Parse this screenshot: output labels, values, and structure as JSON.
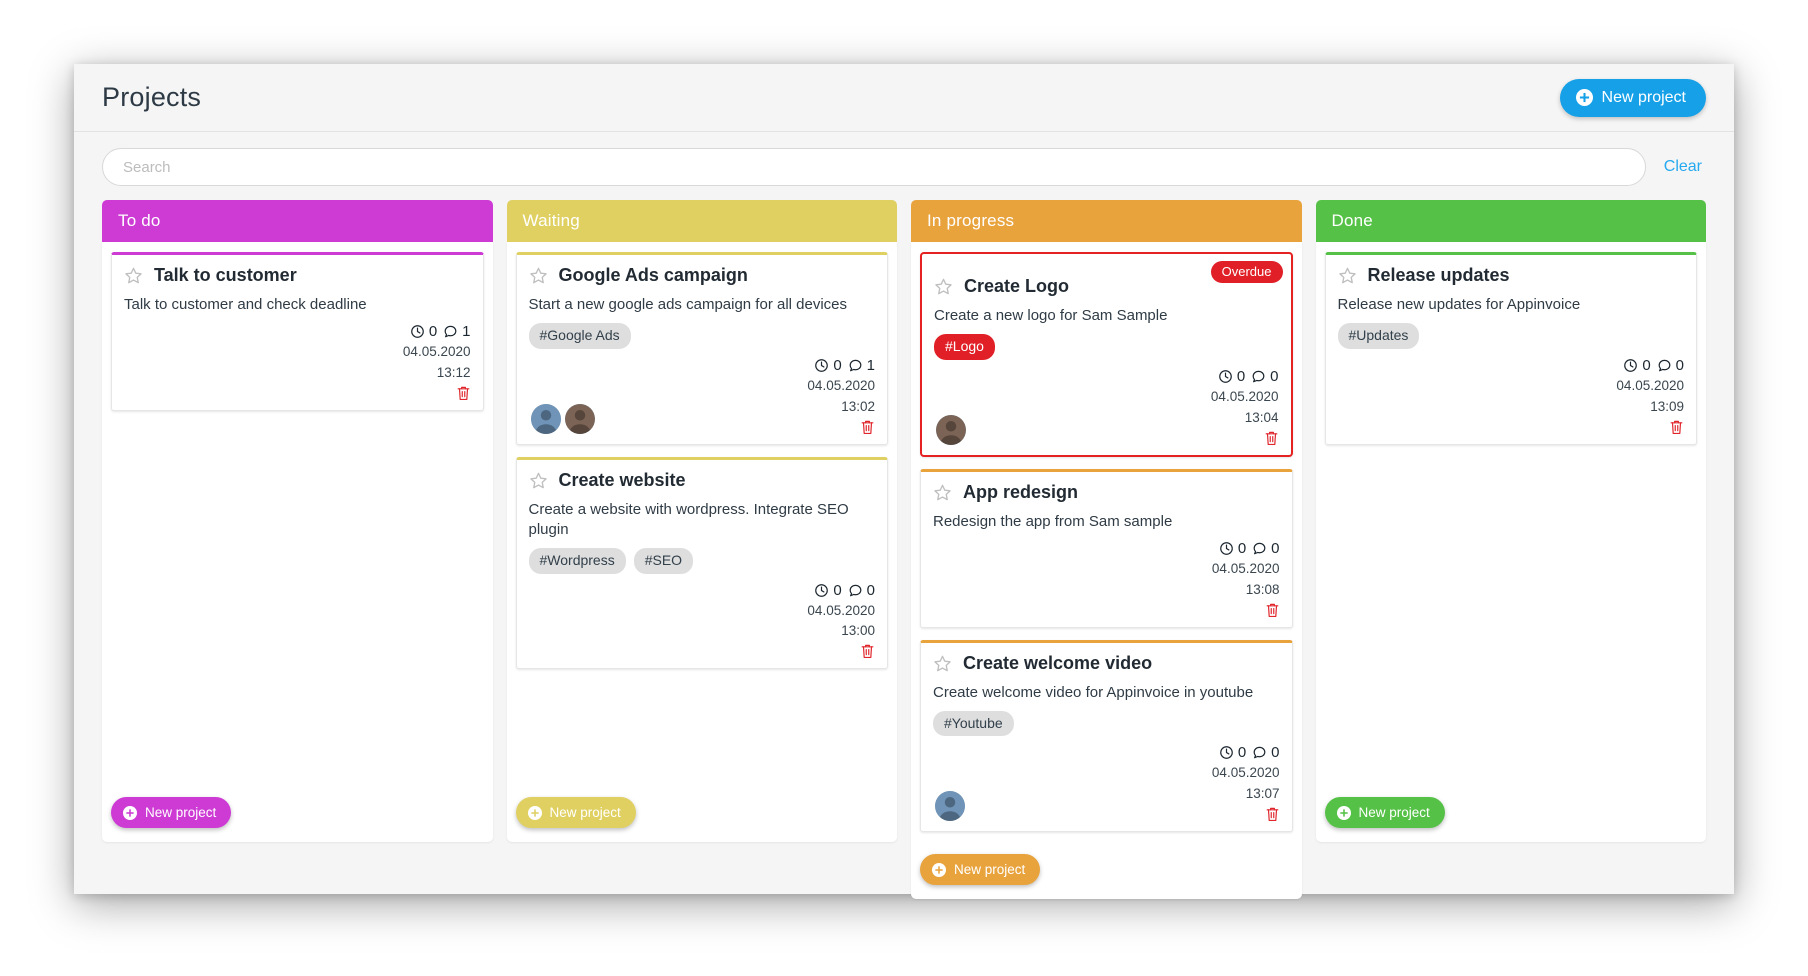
{
  "header": {
    "title": "Projects",
    "new_project_label": "New project",
    "new_project_icon": "plus-circle-icon",
    "accent": "#15a0e8"
  },
  "search": {
    "placeholder": "Search",
    "value": "",
    "clear_label": "Clear"
  },
  "columns": [
    {
      "id": "todo",
      "title": "To do",
      "color": "#cd3ad4",
      "add_label": "New project",
      "cards": [
        {
          "title": "Talk to customer",
          "description": "Talk to customer and check deadline",
          "tags": [],
          "time_count": "0",
          "comment_count": "1",
          "date": "04.05.2020",
          "time": "13:12",
          "avatars": [],
          "badge": null,
          "overdue": false
        }
      ]
    },
    {
      "id": "waiting",
      "title": "Waiting",
      "color": "#e0d062",
      "add_label": "New project",
      "cards": [
        {
          "title": "Google Ads campaign",
          "description": "Start a new google ads campaign for all devices",
          "tags": [
            {
              "label": "#Google Ads",
              "style": "grey"
            }
          ],
          "time_count": "0",
          "comment_count": "1",
          "date": "04.05.2020",
          "time": "13:02",
          "avatars": [
            "#6f94b8",
            "#7b6355"
          ],
          "badge": null,
          "overdue": false
        },
        {
          "title": "Create website",
          "description": "Create a website with wordpress. Integrate SEO plugin",
          "tags": [
            {
              "label": "#Wordpress",
              "style": "grey"
            },
            {
              "label": "#SEO",
              "style": "grey"
            }
          ],
          "time_count": "0",
          "comment_count": "0",
          "date": "04.05.2020",
          "time": "13:00",
          "avatars": [],
          "badge": null,
          "overdue": false
        }
      ]
    },
    {
      "id": "inprogress",
      "title": "In progress",
      "color": "#e8a33d",
      "add_label": "New project",
      "cards": [
        {
          "title": "Create Logo",
          "description": "Create a new logo for Sam Sample",
          "tags": [
            {
              "label": "#Logo",
              "style": "red"
            }
          ],
          "time_count": "0",
          "comment_count": "0",
          "date": "04.05.2020",
          "time": "13:04",
          "avatars": [
            "#7b6355"
          ],
          "badge": "Overdue",
          "overdue": true
        },
        {
          "title": "App redesign",
          "description": "Redesign the app from Sam sample",
          "tags": [],
          "time_count": "0",
          "comment_count": "0",
          "date": "04.05.2020",
          "time": "13:08",
          "avatars": [],
          "badge": null,
          "overdue": false
        },
        {
          "title": "Create welcome video",
          "description": "Create welcome video for Appinvoice in youtube",
          "tags": [
            {
              "label": "#Youtube",
              "style": "grey"
            }
          ],
          "time_count": "0",
          "comment_count": "0",
          "date": "04.05.2020",
          "time": "13:07",
          "avatars": [
            "#6f94b8"
          ],
          "badge": null,
          "overdue": false
        }
      ]
    },
    {
      "id": "done",
      "title": "Done",
      "color": "#56c147",
      "add_label": "New project",
      "cards": [
        {
          "title": "Release updates",
          "description": "Release new updates for Appinvoice",
          "tags": [
            {
              "label": "#Updates",
              "style": "grey"
            }
          ],
          "time_count": "0",
          "comment_count": "0",
          "date": "04.05.2020",
          "time": "13:09",
          "avatars": [],
          "badge": null,
          "overdue": false
        }
      ]
    }
  ],
  "icons": {
    "star": "star-outline-icon",
    "clock": "clock-icon",
    "comment": "comment-icon",
    "trash": "trash-icon",
    "plus": "plus-circle-icon"
  }
}
